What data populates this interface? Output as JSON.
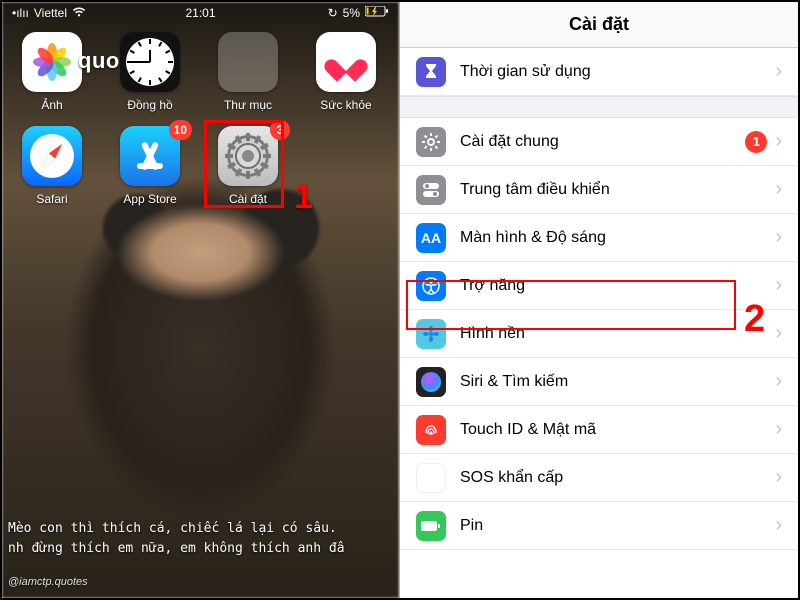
{
  "statusbar": {
    "carrier": "Viettel",
    "time": "21:01",
    "battery_pct": "5%"
  },
  "home": {
    "quote_overlay": "quo",
    "apps_row1": [
      {
        "label": "Ảnh"
      },
      {
        "label": "Đồng hồ"
      },
      {
        "label": "Thư mục"
      },
      {
        "label": "Sức khỏe"
      }
    ],
    "apps_row2": [
      {
        "label": "Safari"
      },
      {
        "label": "App Store",
        "badge": "10"
      },
      {
        "label": "Cài đặt",
        "badge": "3"
      }
    ],
    "bottom_text_l1": "Mèo con thì thích cá, chiếc lá lại có sâu.",
    "bottom_text_l2": "nh đừng thích em nữa, em không thích anh đâ",
    "watermark": "@iamctp.quotes",
    "step1_num": "1"
  },
  "settings": {
    "header": "Cài đặt",
    "rows": [
      {
        "icon": "hourglass",
        "label": "Thời gian sử dụng"
      },
      {
        "icon": "gear",
        "label": "Cài đặt chung",
        "badge": "1"
      },
      {
        "icon": "control",
        "label": "Trung tâm điều khiển"
      },
      {
        "icon": "display",
        "label": "Màn hình & Độ sáng"
      },
      {
        "icon": "access",
        "label": "Trợ năng"
      },
      {
        "icon": "wall",
        "label": "Hình nền"
      },
      {
        "icon": "siri",
        "label": "Siri & Tìm kiếm"
      },
      {
        "icon": "touch",
        "label": "Touch ID & Mật mã"
      },
      {
        "icon": "sos",
        "label": "SOS khẩn cấp"
      },
      {
        "icon": "batt",
        "label": "Pin"
      }
    ],
    "step2_num": "2"
  }
}
